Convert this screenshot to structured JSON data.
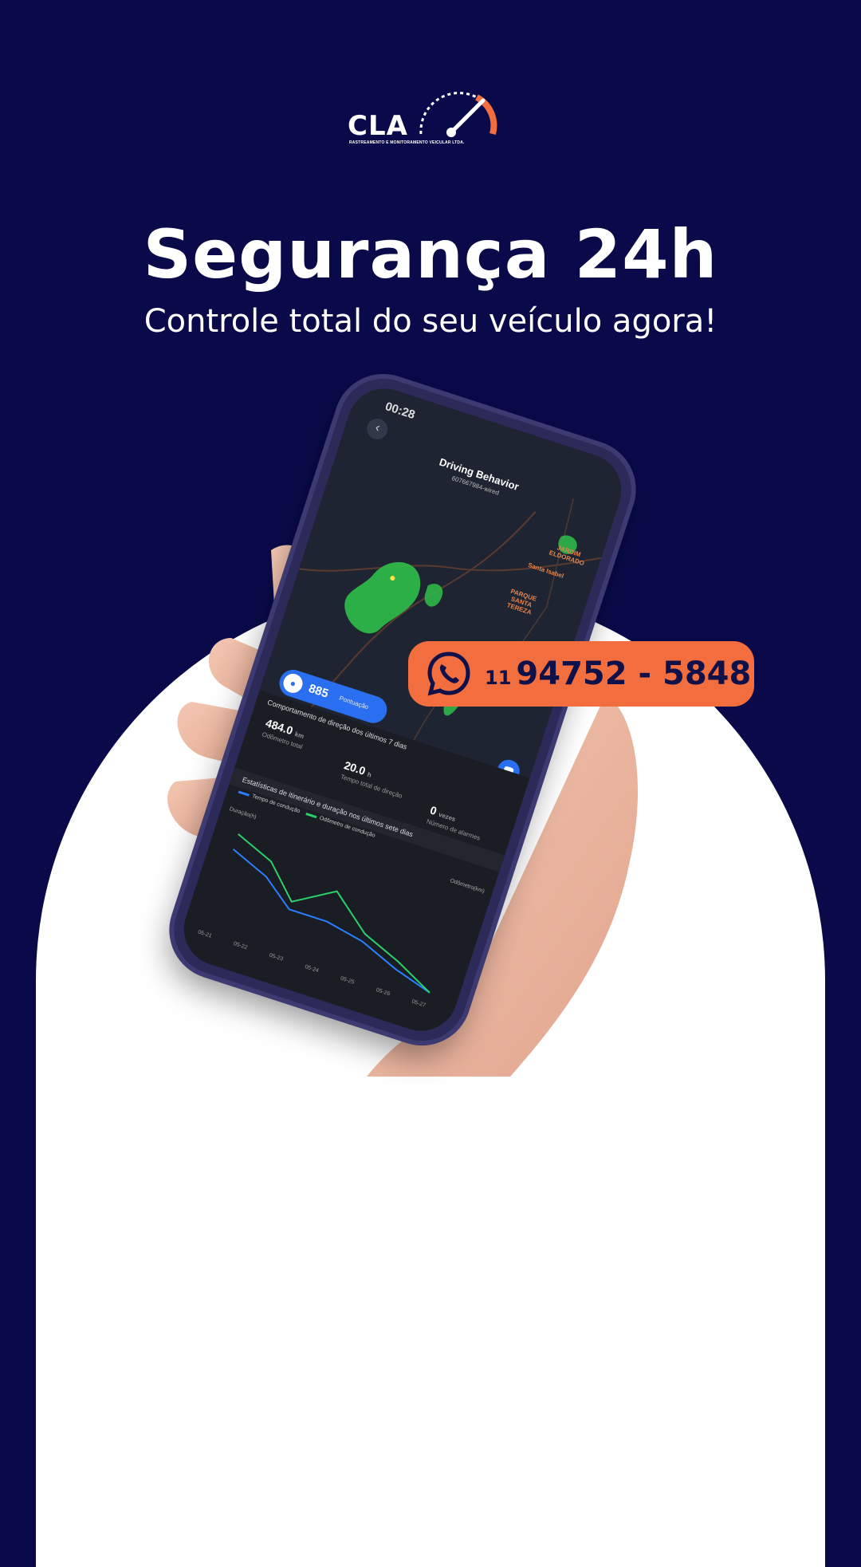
{
  "brand": {
    "name": "CLA",
    "tagline": "RASTREAMENTO E MONITORAMENTO VEICULAR LTDA."
  },
  "headline": "Segurança 24h",
  "subheadline": "Controle total do seu veículo agora!",
  "app": {
    "time": "00:28",
    "title": "Driving Behavior",
    "subtitle": "607667984-wired",
    "places": [
      "JARDIM ELDORADO",
      "Santa Isabel",
      "PARQUE SANTA TEREZA"
    ],
    "score": {
      "value": "885",
      "label": "Pontuação"
    },
    "section1": "Comportamento de direção dos últimos 7 dias",
    "odometer": {
      "value": "484.0",
      "unit": "km",
      "label": "Odômetro total"
    },
    "drive_time": {
      "value": "20.0",
      "unit": "h",
      "label": "Tempo total de direção"
    },
    "alarms": {
      "value": "0",
      "unit": "vezes",
      "label": "Número de alarmes"
    },
    "section2": "Estatísticas de itinerário e duração nos últimos sete dias",
    "legend": [
      "Tempo de condução",
      "Odômetro de condução"
    ],
    "y_left_label": "Duração(h)",
    "y_right_label": "Odômetro(km)",
    "x_ticks": [
      "05-21",
      "05-22",
      "05-23",
      "05-24",
      "05-25",
      "05-26",
      "05-27"
    ],
    "series_colors": {
      "time": "#2a7fff",
      "odometer": "#2ad06a"
    }
  },
  "contact": {
    "ddd": "11",
    "number": "94752 - 5848"
  },
  "colors": {
    "background": "#0a0a4a",
    "accent": "#f26e3e",
    "arch": "#ffffff"
  }
}
